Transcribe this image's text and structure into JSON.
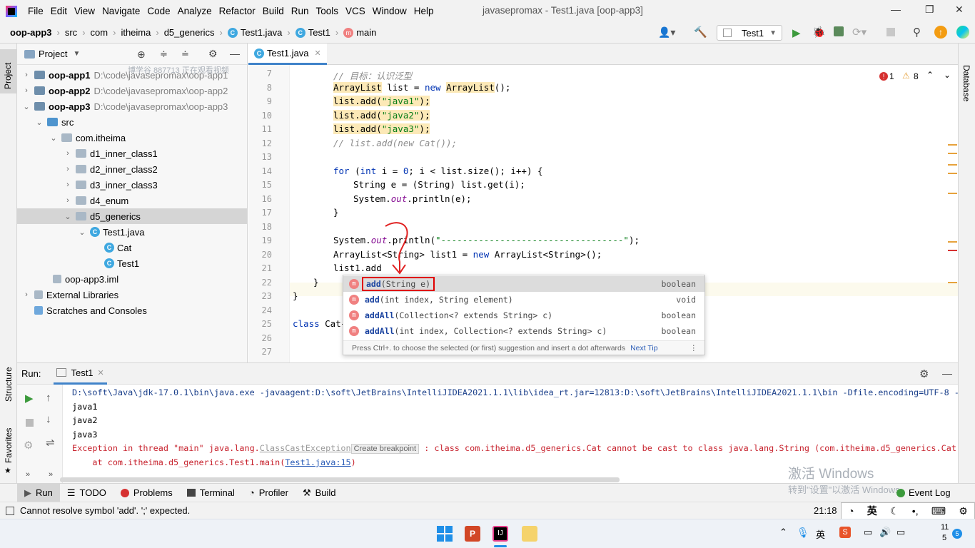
{
  "menubar": {
    "items": [
      "File",
      "Edit",
      "View",
      "Navigate",
      "Code",
      "Analyze",
      "Refactor",
      "Build",
      "Run",
      "Tools",
      "VCS",
      "Window",
      "Help"
    ],
    "title": "javasepromax - Test1.java [oop-app3]"
  },
  "navbar": {
    "crumbs": [
      "oop-app3",
      "src",
      "com",
      "itheima",
      "d5_generics",
      "Test1.java",
      "Test1",
      "main"
    ],
    "run_config": "Test1"
  },
  "leftstrip": {
    "project": "Project",
    "structure": "Structure",
    "favorites": "Favorites"
  },
  "rightstrip": {
    "database": "Database"
  },
  "project": {
    "title": "Project",
    "watermark": "博学谷 887713 正在观看视频",
    "tree": [
      {
        "label": "oop-app1",
        "path": "D:\\code\\javasepromax\\oop-app1"
      },
      {
        "label": "oop-app2",
        "path": "D:\\code\\javasepromax\\oop-app2"
      },
      {
        "label": "oop-app3",
        "path": "D:\\code\\javasepromax\\oop-app3"
      },
      {
        "label": "src"
      },
      {
        "label": "com.itheima"
      },
      {
        "label": "d1_inner_class1"
      },
      {
        "label": "d2_inner_class2"
      },
      {
        "label": "d3_inner_class3"
      },
      {
        "label": "d4_enum"
      },
      {
        "label": "d5_generics"
      },
      {
        "label": "Test1.java"
      },
      {
        "label": "Cat"
      },
      {
        "label": "Test1"
      },
      {
        "label": "oop-app3.iml"
      },
      {
        "label": "External Libraries"
      },
      {
        "label": "Scratches and Consoles"
      }
    ]
  },
  "editor": {
    "tab": "Test1.java",
    "errors": "1",
    "warnings": "8",
    "line_numbers": [
      "7",
      "8",
      "9",
      "10",
      "11",
      "12",
      "13",
      "14",
      "15",
      "16",
      "17",
      "18",
      "19",
      "20",
      "21",
      "22",
      "23",
      "24",
      "25",
      "26",
      "27"
    ],
    "code": {
      "l7": "// 目标：认识泛型",
      "l8a": "ArrayList",
      "l8b": " list = ",
      "l8c": "new ",
      "l8d": "ArrayList",
      "l8e": "();",
      "l9a": "list.add(",
      "l9b": "\"java1\"",
      "l9c": ");",
      "l10a": "list.add(",
      "l10b": "\"java2\"",
      "l10c": ");",
      "l11a": "list.add(",
      "l11b": "\"java3\"",
      "l11c": ");",
      "l12": "// list.add(new Cat());",
      "l14a": "for",
      "l14b": " (",
      "l14c": "int",
      "l14d": " i = ",
      "l14e": "0",
      "l14f": "; i < list.size(); i++) {",
      "l15": "String e = (String) list.get(i);",
      "l16a": "System.",
      "l16b": "out",
      "l16c": ".println(e);",
      "l17": "}",
      "l19a": "System.",
      "l19b": "out",
      "l19c": ".println(",
      "l19d": "\"----------------------------------\"",
      "l19e": ");",
      "l20a": "ArrayList<String> list1 = ",
      "l20b": "new ",
      "l20c": "ArrayList<String>();",
      "l21": "list1.add",
      "l22": "}",
      "l23": "}",
      "l25a": "class ",
      "l25b": "Cat{"
    }
  },
  "completion": {
    "items": [
      {
        "name": "add",
        "sig": "(String e)",
        "type": "boolean"
      },
      {
        "name": "add",
        "sig": "(int index, String element)",
        "type": "void"
      },
      {
        "name": "addAll",
        "sig": "(Collection<? extends String> c)",
        "type": "boolean"
      },
      {
        "name": "addAll",
        "sig": "(int index, Collection<? extends String> c)",
        "type": "boolean"
      }
    ],
    "hint": "Press Ctrl+. to choose the selected (or first) suggestion and insert a dot afterwards",
    "next_tip": "Next Tip"
  },
  "run": {
    "label": "Run:",
    "tab": "Test1",
    "lines": {
      "cmd": "D:\\soft\\Java\\jdk-17.0.1\\bin\\java.exe -javaagent:D:\\soft\\JetBrains\\IntelliJIDEA2021.1.1\\lib\\idea_rt.jar=12813:D:\\soft\\JetBrains\\IntelliJIDEA2021.1.1\\bin -Dfile.encoding=UTF-8 -",
      "o1": "java1",
      "o2": "java2",
      "o3": "java3",
      "exc_a": "Exception in thread \"main\" java.lang.",
      "exc_b": "ClassCastException",
      "exc_tip": "Create breakpoint",
      "exc_c": " : class com.itheima.d5_generics.Cat cannot be cast to class java.lang.String (com.itheima.d5_generics.Cat",
      "at_a": "    at com.itheima.d5_generics.Test1.main(",
      "at_b": "Test1.java:15",
      "at_c": ")"
    }
  },
  "toolwindows": [
    "Run",
    "TODO",
    "Problems",
    "Terminal",
    "Profiler",
    "Build"
  ],
  "event_log": "Event Log",
  "status": {
    "message": "Cannot resolve symbol 'add'. ';' expected.",
    "time": "21:18",
    "ime": "英"
  },
  "watermark": {
    "line1": "激活 Windows",
    "line2": "转到\"设置\"以激活 Windows。"
  },
  "taskbar": {
    "lang": "英",
    "time": "11",
    "date": "5",
    "badge": "5"
  }
}
